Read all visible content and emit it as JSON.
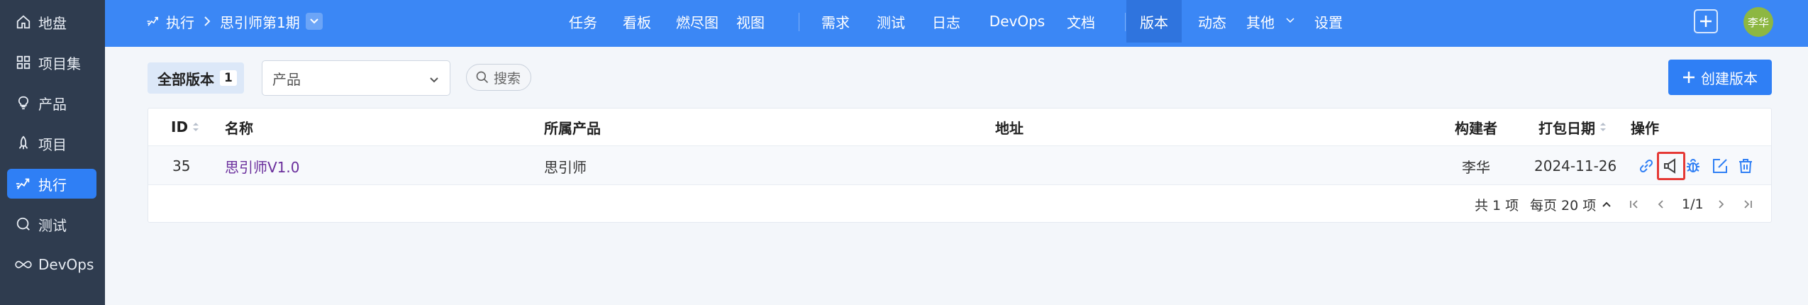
{
  "sidebar": {
    "items": [
      {
        "label": "地盘",
        "icon": "home-icon",
        "active": false
      },
      {
        "label": "项目集",
        "icon": "grid-icon",
        "active": false
      },
      {
        "label": "产品",
        "icon": "bulb-icon",
        "active": false
      },
      {
        "label": "项目",
        "icon": "rocket-icon",
        "active": false
      },
      {
        "label": "执行",
        "icon": "run-icon",
        "active": true
      },
      {
        "label": "测试",
        "icon": "magnifier-icon",
        "active": false
      },
      {
        "label": "DevOps",
        "icon": "infinity-icon",
        "active": false
      }
    ]
  },
  "header": {
    "breadcrumb_root": "执行",
    "breadcrumb_current": "思引师第1期",
    "nav": [
      {
        "label": "任务"
      },
      {
        "label": "看板"
      },
      {
        "label": "燃尽图"
      },
      {
        "label": "视图"
      },
      {
        "label": "需求"
      },
      {
        "label": "测试"
      },
      {
        "label": "日志"
      },
      {
        "label": "DevOps"
      },
      {
        "label": "文档"
      },
      {
        "label": "版本",
        "active": true
      },
      {
        "label": "动态"
      },
      {
        "label": "其他"
      },
      {
        "label": "设置"
      }
    ],
    "avatar_text": "李华"
  },
  "toolbar": {
    "all_versions_label": "全部版本",
    "all_versions_count": "1",
    "product_select_value": "产品",
    "search_label": "搜索",
    "create_label": "创建版本"
  },
  "table": {
    "columns": {
      "id": "ID",
      "name": "名称",
      "product": "所属产品",
      "address": "地址",
      "builder": "构建者",
      "date": "打包日期",
      "actions": "操作"
    },
    "rows": [
      {
        "id": "35",
        "name": "思引师V1.0",
        "product": "思引师",
        "address": "",
        "builder": "李华",
        "date": "2024-11-26"
      }
    ]
  },
  "pager": {
    "total": "共 1 项",
    "per_page": "每页 20 项",
    "page": "1/1"
  },
  "colors": {
    "header_blue": "#3b87f5",
    "sidebar_bg": "#2f3c4f",
    "accent": "#2f7ff5",
    "link_purple": "#6a2e9c",
    "highlight_red": "#e53935"
  }
}
